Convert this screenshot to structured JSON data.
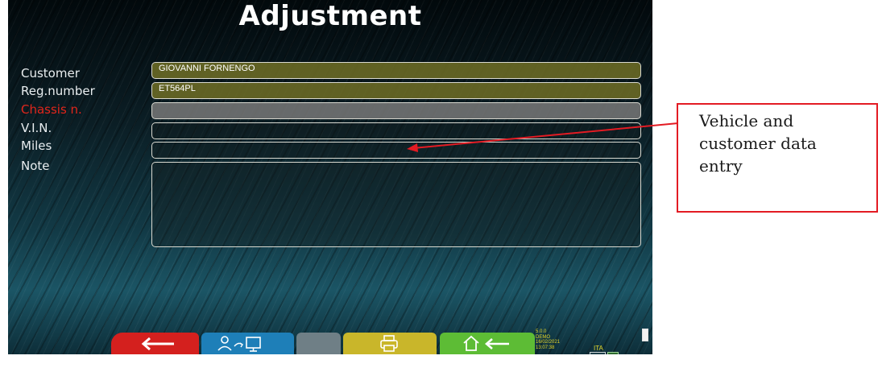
{
  "screen": {
    "title": "Adjustment"
  },
  "form": {
    "fields": [
      {
        "label": "Customer",
        "value": "GIOVANNI FORNENGO"
      },
      {
        "label": "Reg.number",
        "value": "ET564PL"
      },
      {
        "label": "Chassis n.",
        "value": ""
      },
      {
        "label": "V.I.N.",
        "value": ""
      },
      {
        "label": "Miles",
        "value": ""
      },
      {
        "label": "Note",
        "value": ""
      }
    ]
  },
  "toolbar": {
    "buttons": [
      {
        "name": "back",
        "icon": "arrow-left-icon",
        "color": "#d4201e"
      },
      {
        "name": "user-to-screen",
        "icon": "user-to-monitor-icon",
        "color": "#1e7fb8"
      },
      {
        "name": "blank",
        "icon": "",
        "color": "#6f7f86"
      },
      {
        "name": "print",
        "icon": "printer-icon",
        "color": "#c9b62a"
      },
      {
        "name": "home",
        "icon": "home-back-icon",
        "color": "#5dbc35"
      }
    ]
  },
  "status": {
    "version": "5.0.0",
    "mode": "DEMO",
    "date": "16/02/2021",
    "time": "13:07:38",
    "language": "ITA"
  },
  "annotation": {
    "text_line1": "Vehicle and",
    "text_line2": "customer data",
    "text_line3": "entry",
    "color": "#e31b23"
  }
}
